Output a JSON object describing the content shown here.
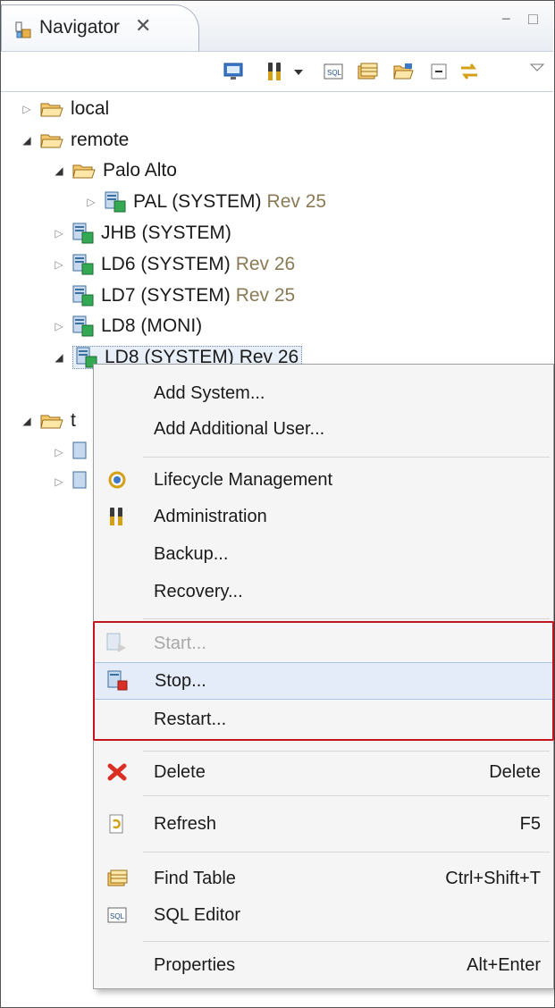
{
  "tab": {
    "title": "Navigator",
    "close": "✕"
  },
  "window_controls": {
    "minimize": "−",
    "maximize": "□"
  },
  "toolbar": {
    "items": [
      "system-monitor-icon",
      "administration-icon",
      "dropdown-arrow-icon",
      "sql-icon",
      "find-table-icon",
      "open-folder-icon",
      "collapse-all-icon",
      "link-editor-icon",
      "view-menu-icon"
    ]
  },
  "tree": {
    "local": "local",
    "remote": "remote",
    "palo_alto": "Palo Alto",
    "pal": {
      "name": "PAL (SYSTEM)",
      "rev": "Rev 25"
    },
    "jhb": {
      "name": "JHB (SYSTEM)"
    },
    "ld6": {
      "name": "LD6 (SYSTEM)",
      "rev": "Rev 26"
    },
    "ld7": {
      "name": "LD7 (SYSTEM)",
      "rev": "Rev 25"
    },
    "ld8_moni": {
      "name": "LD8 (MONI)"
    },
    "ld8_system": {
      "name": "LD8 (SYSTEM)",
      "rev": "Rev 26"
    },
    "t_folder": "t"
  },
  "context_menu": {
    "add_system": "Add System...",
    "add_user": "Add Additional User...",
    "lifecycle": "Lifecycle Management",
    "administration": "Administration",
    "backup": "Backup...",
    "recovery": "Recovery...",
    "start": "Start...",
    "stop": "Stop...",
    "restart": "Restart...",
    "delete": "Delete",
    "delete_accel": "Delete",
    "refresh": "Refresh",
    "refresh_accel": "F5",
    "find_table": "Find Table",
    "find_table_accel": "Ctrl+Shift+T",
    "sql_editor": "SQL Editor",
    "properties": "Properties",
    "properties_accel": "Alt+Enter"
  },
  "colors": {
    "highlight_box": "#c4141d",
    "revision_text": "#8a7a55",
    "hover": "#e3ecf8"
  }
}
